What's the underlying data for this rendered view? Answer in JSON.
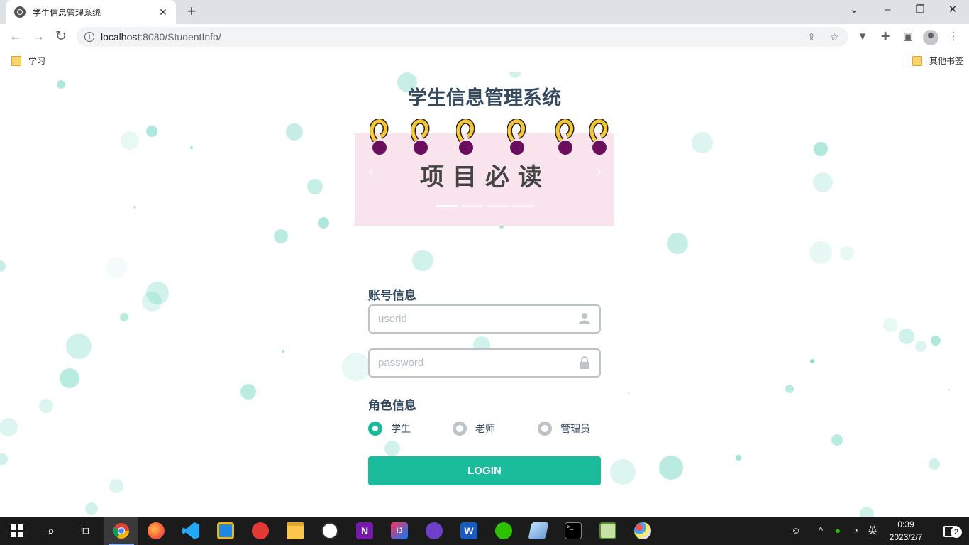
{
  "browser": {
    "tab_title": "学生信息管理系统",
    "tab_close": "✕",
    "new_tab": "+",
    "url_host": "localhost",
    "url_path": ":8080/StudentInfo/",
    "bookmarks": [
      {
        "label": "学习"
      },
      {
        "label": "其他书签"
      }
    ]
  },
  "page": {
    "title": "学生信息管理系统",
    "banner_text": "项目必读",
    "carousel_prev": "‹",
    "carousel_next": "›",
    "carousel_active_index": 0,
    "carousel_slide_count": 4
  },
  "form": {
    "account_label": "账号信息",
    "userid_placeholder": "userid",
    "password_placeholder": "password",
    "role_label": "角色信息",
    "roles": [
      {
        "label": "学生",
        "selected": true
      },
      {
        "label": "老师",
        "selected": false
      },
      {
        "label": "管理员",
        "selected": false
      }
    ],
    "login_label": "LOGIN"
  },
  "taskbar": {
    "apps": [
      "start",
      "search",
      "task-view",
      "chrome",
      "firefox",
      "vscode",
      "app-blue",
      "app-red",
      "file-explorer",
      "app-dog",
      "onenote",
      "intellij",
      "github",
      "word",
      "wechat",
      "app-pen",
      "terminal",
      "notepad",
      "paint"
    ],
    "ime": "英",
    "time": "0:39",
    "date": "2023/2/7",
    "notification_count": "2"
  },
  "colors": {
    "accent": "#1abc9c",
    "title": "#34495e",
    "banner_bg": "#f9e4ee"
  }
}
